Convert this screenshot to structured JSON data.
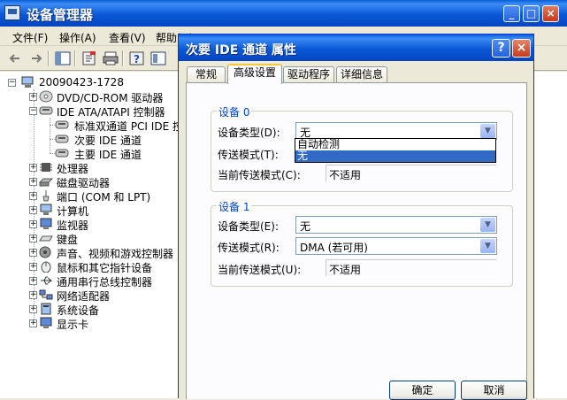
{
  "device_manager": {
    "title": "设备管理器",
    "menu": [
      "文件(F)",
      "操作(A)",
      "查看(V)",
      "帮助(H)"
    ],
    "tree": {
      "root": "20090423-1728",
      "items": [
        {
          "label": "DVD/CD-ROM 驱动器",
          "icon": "cdrom-icon"
        },
        {
          "label": "IDE ATA/ATAPI 控制器",
          "icon": "ide-controller-icon",
          "expanded": true,
          "children": [
            "标准双通道 PCI IDE 控制器",
            "次要 IDE 通道",
            "主要 IDE 通道"
          ]
        },
        {
          "label": "处理器",
          "icon": "processor-icon"
        },
        {
          "label": "磁盘驱动器",
          "icon": "disk-drive-icon"
        },
        {
          "label": "端口 (COM 和 LPT)",
          "icon": "port-icon"
        },
        {
          "label": "计算机",
          "icon": "computer-icon"
        },
        {
          "label": "监视器",
          "icon": "monitor-icon"
        },
        {
          "label": "键盘",
          "icon": "keyboard-icon"
        },
        {
          "label": "声音、视频和游戏控制器",
          "icon": "sound-icon"
        },
        {
          "label": "鼠标和其它指针设备",
          "icon": "mouse-icon"
        },
        {
          "label": "通用串行总线控制器",
          "icon": "usb-icon"
        },
        {
          "label": "网络适配器",
          "icon": "network-adapter-icon"
        },
        {
          "label": "系统设备",
          "icon": "system-device-icon"
        },
        {
          "label": "显示卡",
          "icon": "display-adapter-icon"
        }
      ]
    }
  },
  "dialog": {
    "title": "次要 IDE 通道 属性",
    "help": "?",
    "close": "×",
    "tabs": [
      "常规",
      "高级设置",
      "驱动程序",
      "详细信息"
    ],
    "active_tab": "高级设置",
    "device0": {
      "group_title": "设备 0",
      "type_label": "设备类型(D):",
      "type_value": "无",
      "mode_label": "传送模式(T):",
      "current_label": "当前传送模式(C):",
      "current_value": "不适用",
      "dropdown_options": [
        "自动检测",
        "无"
      ],
      "dropdown_selected": "无"
    },
    "device1": {
      "group_title": "设备 1",
      "type_label": "设备类型(E):",
      "type_value": "无",
      "mode_label": "传送模式(R):",
      "mode_value": "DMA (若可用)",
      "current_label": "当前传送模式(U):",
      "current_value": "不适用"
    },
    "buttons": {
      "ok": "确定",
      "cancel": "取消"
    }
  }
}
